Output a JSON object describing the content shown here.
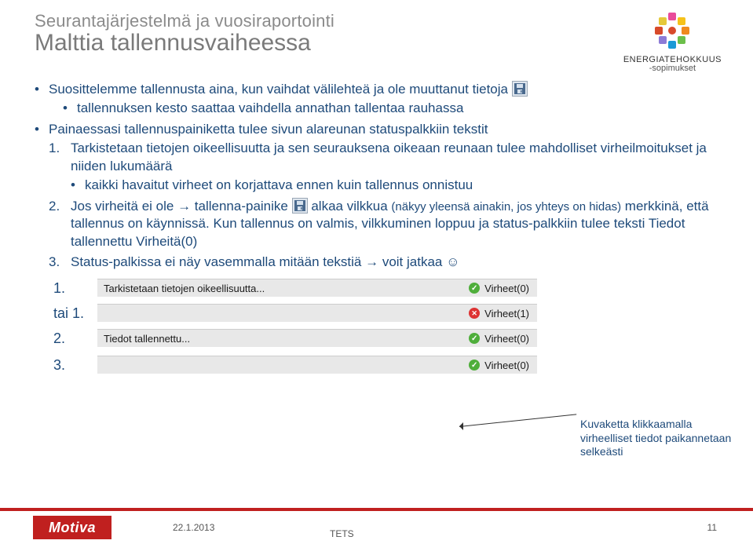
{
  "header": {
    "supertitle": "Seurantajärjestelmä ja vuosiraportointi",
    "title": "Malttia tallennusvaiheessa",
    "logo": {
      "top": "ENERGIATEHOKKUUS",
      "sub": "-sopimukset"
    }
  },
  "bullets": {
    "b1a": "Suosittelemme tallennusta aina, kun vaihdat välilehteä ja ole muuttanut tietoja ",
    "b1sub": "tallennuksen kesto saattaa vaihdella annathan tallentaa rauhassa",
    "b2": "Painaessasi tallennuspainiketta tulee sivun alareunan statuspalkkiin tekstit",
    "o1": "Tarkistetaan tietojen oikeellisuutta ja sen seurauksena oikeaan reunaan tulee mahdolliset virheilmoitukset ja niiden lukumäärä",
    "o1sub": "kaikki havaitut virheet on korjattava ennen kuin tallennus onnistuu",
    "o2a": "Jos virheitä ei ole → tallenna-painike ",
    "o2b": " alkaa vilkkua ",
    "o2b_small": "(näkyy yleensä ainakin, jos yhteys on hidas)",
    "o2c": " merkkinä, että tallennus on käynnissä. Kun tallennus on valmis, vilkkuminen loppuu ja status-palkkiin tulee teksti Tiedot tallennettu  Virheitä(0)",
    "o3": "Status-palkissa ei näy vasemmalla mitään tekstiä → voit jatkaa ☺"
  },
  "status": {
    "rows": [
      {
        "label": "1.",
        "left": "Tarkistetaan tietojen oikeellisuutta...",
        "icon": "ok",
        "right": "Virheet(0)"
      },
      {
        "label": "tai 1.",
        "left": "",
        "icon": "err",
        "right": "Virheet(1)"
      },
      {
        "label": "2.",
        "left": "Tiedot tallennettu...",
        "icon": "ok",
        "right": "Virheet(0)"
      },
      {
        "label": "3.",
        "left": "",
        "icon": "ok",
        "right": "Virheet(0)"
      }
    ]
  },
  "callout": "Kuvaketta klikkaamalla virheelliset tiedot paikan­netaan selkeästi",
  "footer": {
    "brand": "Motiva",
    "date": "22.1.2013",
    "tag": "TETS",
    "page": "11"
  }
}
